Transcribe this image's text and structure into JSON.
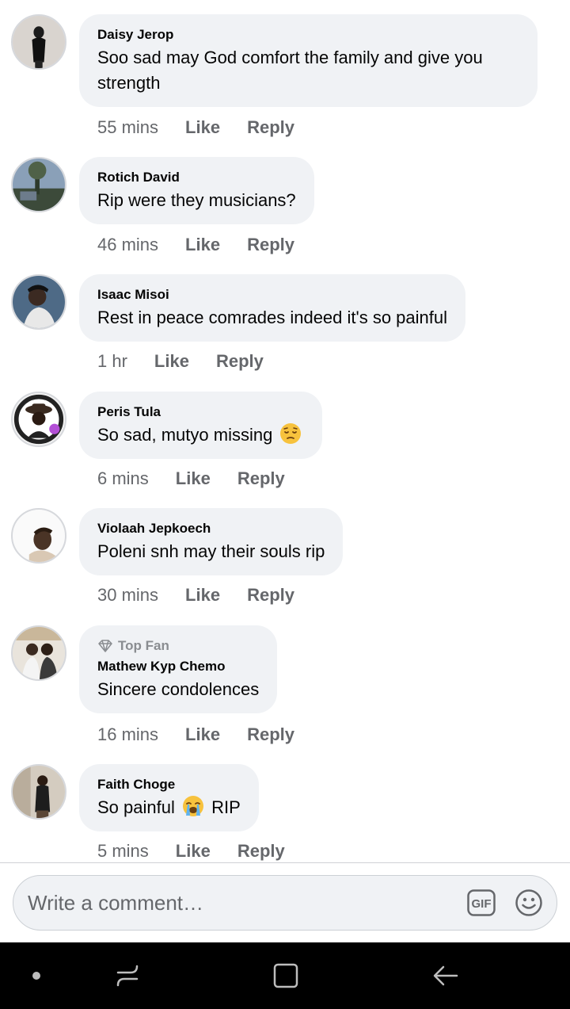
{
  "comments": [
    {
      "author": "Daisy Jerop",
      "text_line1": "Soo sad may God comfort the family and give you",
      "text_line2": "strength",
      "time": "55 mins",
      "like": "Like",
      "reply": "Reply"
    },
    {
      "author": "Rotich David",
      "text": "Rip were they musicians?",
      "time": "46 mins",
      "like": "Like",
      "reply": "Reply"
    },
    {
      "author": "Isaac Misoi",
      "text": "Rest in peace comrades indeed it's so painful",
      "time": "1 hr",
      "like": "Like",
      "reply": "Reply"
    },
    {
      "author": "Peris Tula",
      "text": "So sad,  mutyo missing",
      "emoji": "pensive-face",
      "time": "6 mins",
      "like": "Like",
      "reply": "Reply"
    },
    {
      "author": "Violaah Jepkoech",
      "text": "Poleni snh may their souls rip",
      "time": "30 mins",
      "like": "Like",
      "reply": "Reply"
    },
    {
      "badge": "Top Fan",
      "author": "Mathew Kyp Chemo",
      "text": "Sincere condolences",
      "time": "16 mins",
      "like": "Like",
      "reply": "Reply"
    },
    {
      "author": "Faith Choge",
      "text_before": "So painful",
      "emoji": "loudly-crying-face",
      "text_after": "RIP",
      "time": "5 mins",
      "like": "Like",
      "reply": "Reply"
    }
  ],
  "composer": {
    "placeholder": "Write a comment…",
    "gif_icon": "gif-icon",
    "emoji_icon": "smiley-icon"
  },
  "navbar": {
    "items": [
      "dot-icon",
      "recent-apps-icon",
      "home-icon",
      "back-icon"
    ]
  },
  "colors": {
    "bubble": "#f0f2f5",
    "meta_text": "#65676b",
    "navbar": "#000000"
  }
}
